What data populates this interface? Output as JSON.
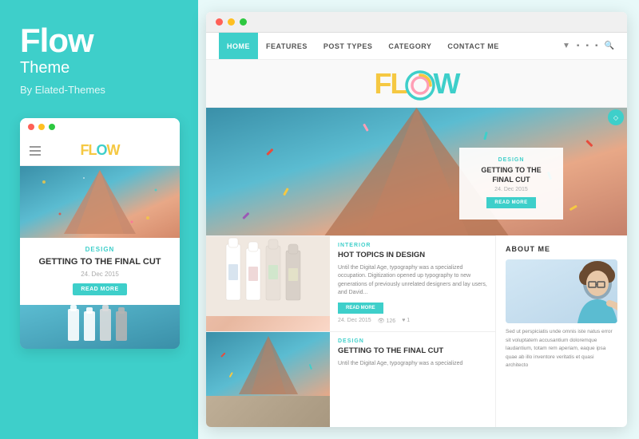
{
  "brand": {
    "title": "Flow",
    "subtitle": "Theme",
    "author": "By Elated-Themes"
  },
  "mobile_preview": {
    "category": "DESIGN",
    "blog_title": "GETTING TO THE FINAL CUT",
    "date": "24. Dec 2015",
    "read_more": "READ MORE"
  },
  "nav": {
    "items": [
      {
        "label": "HOME",
        "active": true
      },
      {
        "label": "FEATURES",
        "active": false
      },
      {
        "label": "POST TYPES",
        "active": false
      },
      {
        "label": "CATEGORY",
        "active": false
      },
      {
        "label": "CONTACT ME",
        "active": false
      }
    ]
  },
  "site_logo": "FLOW",
  "hero": {
    "category": "DESIGN",
    "title": "GETTING TO THE FINAL CUT",
    "date": "24. Dec 2015",
    "read_more": "READ MORE"
  },
  "post1": {
    "category": "INTERIOR",
    "title": "HOT TOPICS IN DESIGN",
    "excerpt": "Until the Digital Age, typography was a specialized occupation. Digitization opened up typography to new generations of previously unrelated designers and lay users, and David...",
    "read_more": "READ MORE",
    "date": "24. Dec 2015",
    "views": "126",
    "likes": "1"
  },
  "post2": {
    "category": "DESIGN",
    "title": "GETTING TO THE FINAL CUT",
    "excerpt": "Until the Digital Age, typography was a specialized"
  },
  "sidebar": {
    "title": "ABOUT ME",
    "text": "Sed ut perspiciatis unde omnis iste natus error sit voluptatem accusantium doloremque laudantium, totam rem aperiam, eaque ipsa quae ab illo inventore veritatis et quasi architecto"
  }
}
